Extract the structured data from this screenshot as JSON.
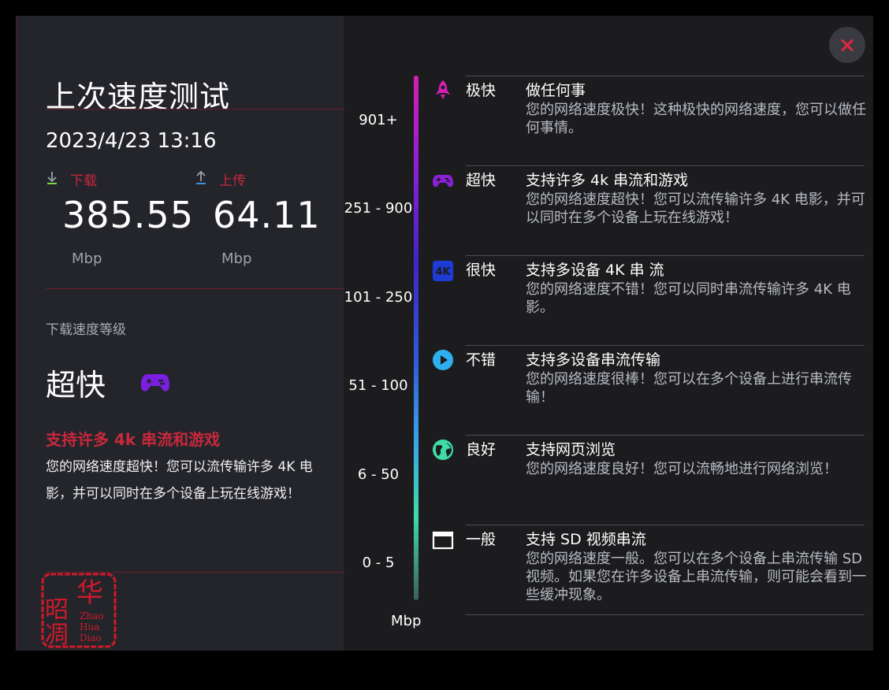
{
  "panel": {
    "title": "上次速度测试",
    "datetime": "2023/4/23 13:16",
    "download_label": "下载",
    "upload_label": "上传",
    "download_value": "385.55",
    "upload_value": "64.11",
    "download_unit": "Mbp",
    "upload_unit": "Mbp",
    "grade_label": "下载速度等级",
    "grade": "超快",
    "grade_title": "支持许多 4k 串流和游戏",
    "grade_desc": "您的网络速度超快！您可以流传输许多 4K 电影，并可以同时在多个设备上玩在线游戏！"
  },
  "scale": {
    "ticks": [
      "901+",
      "251 - 900",
      "101 - 250",
      "51 - 100",
      "6 - 50",
      "0 - 5"
    ],
    "unit": "Mbp"
  },
  "tiers": [
    {
      "name": "极快",
      "title": "做任何事",
      "desc": "您的网络速度极快！这种极快的网络速度，您可以做任何事情。",
      "icon": "rocket-icon"
    },
    {
      "name": "超快",
      "title": "支持许多 4k 串流和游戏",
      "desc": "您的网络速度超快！您可以流传输许多 4K 电影，并可以同时在多个设备上玩在线游戏！",
      "icon": "gamepad-icon"
    },
    {
      "name": "很快",
      "title": "支持多设备 4K 串 流",
      "desc": "您的网络速度不错！您可以同时串流传输许多 4K 电影。",
      "icon": "4k-icon"
    },
    {
      "name": "不错",
      "title": "支持多设备串流传输",
      "desc": "您的网络速度很棒！您可以在多个设备上进行串流传输！",
      "icon": "play-icon"
    },
    {
      "name": "良好",
      "title": "支持网页浏览",
      "desc": "您的网络速度良好！您可以流畅地进行网络浏览！",
      "icon": "globe-icon"
    },
    {
      "name": "一般",
      "title": "支持 SD 视频串流",
      "desc": "您的网络速度一般。您可以在多个设备上串流传输 SD 视频。如果您在许多设备上串流传输，则可能会看到一些缓冲现象。",
      "icon": "browser-window-icon"
    }
  ],
  "seal": {
    "text_cn": "昭华凋",
    "text_en": "Zhao Hua Diao"
  },
  "colors": {
    "accent": "#c8283c",
    "close": "#e0283e",
    "gamepad": "#7a1fe0"
  }
}
